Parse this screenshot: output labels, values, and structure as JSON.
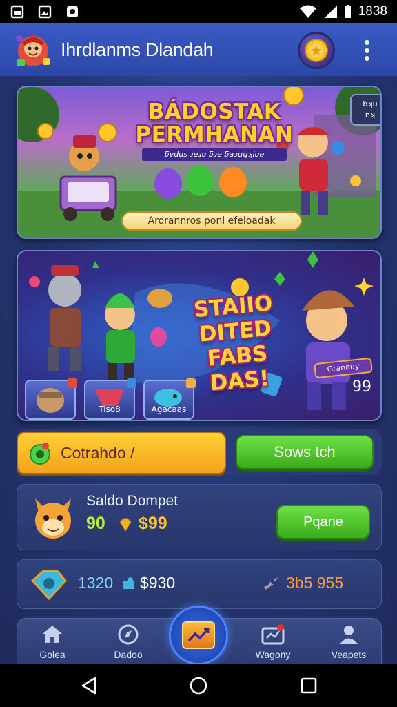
{
  "status_bar": {
    "time": "1838",
    "left_icons": [
      "photo-icon",
      "image-icon",
      "notification-icon"
    ],
    "right_icons": [
      "wifi-icon",
      "signal-icon",
      "battery-icon"
    ]
  },
  "header": {
    "title": "Ihrdlanms Dlandah",
    "logo_icon": "mascot-logo-icon",
    "coin_icon": "coin-icon",
    "menu_icon": "more-vertical-icon"
  },
  "banner_1": {
    "title_line1": "BÁDOSTAK",
    "title_line2": "PERMHANAN",
    "subtitle": "ƃvdus ɹeɹu ƃɹe ƃaɔuɥʞiue",
    "badge": "ƃʞu\nnʞ",
    "cta": "Arorannros ponl efeloadak"
  },
  "banner_2": {
    "title_line1": "STAIIO DITED",
    "title_line2": "FABS DAS!",
    "tag": "Granauy",
    "count": "99",
    "mini_cards": [
      {
        "label": ""
      },
      {
        "label": "Tiso8"
      },
      {
        "label": "Agacaas"
      }
    ]
  },
  "actions": {
    "primary_label": "Cotrahdo /",
    "secondary_label": "Sows tch"
  },
  "wallet": {
    "title": "Saldo Dompet",
    "points": "90",
    "money": "$99",
    "button_label": "Pqane"
  },
  "stats": {
    "value": "1320",
    "money": "$930",
    "right_value": "3b5 955"
  },
  "bottom_nav": {
    "items": [
      {
        "label": "Golea",
        "icon": "home-icon"
      },
      {
        "label": "Dadoo",
        "icon": "compass-icon"
      },
      {
        "label": "Wagony",
        "icon": "wallet-icon"
      },
      {
        "label": "Veapets",
        "icon": "profile-icon"
      }
    ],
    "center_icon": "chart-icon"
  },
  "colors": {
    "header_bg": "#3a5bc4",
    "primary_orange": "#f4a41c",
    "primary_green": "#3caa1c",
    "wallet_points": "#b8f03a",
    "wallet_money": "#ffc52e"
  }
}
